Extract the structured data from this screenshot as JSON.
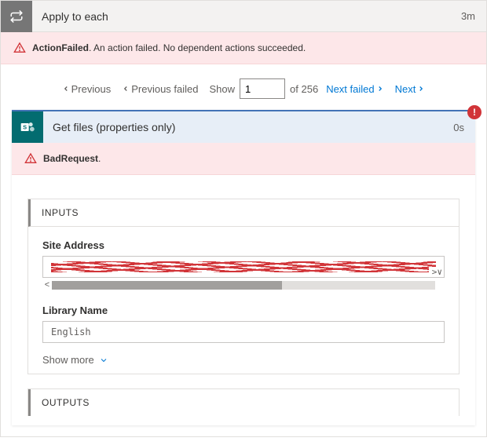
{
  "outer": {
    "title": "Apply to each",
    "duration": "3m"
  },
  "error_outer": {
    "title": "ActionFailed",
    "message": ". An action failed. No dependent actions succeeded."
  },
  "pager": {
    "prev": "Previous",
    "prev_failed": "Previous failed",
    "show": "Show",
    "page": "1",
    "of_total": "of 256",
    "next_failed": "Next failed",
    "next": "Next"
  },
  "inner": {
    "title": "Get files (properties only)",
    "duration": "0s",
    "badge": "!"
  },
  "error_inner": {
    "title": "BadRequest",
    "message": "."
  },
  "sections": {
    "inputs": "INPUTS",
    "outputs": "OUTPUTS"
  },
  "fields": {
    "site_address_label": "Site Address",
    "site_address_value": "[redacted URL]",
    "library_name_label": "Library Name",
    "library_name_value": "English"
  },
  "show_more": "Show more"
}
